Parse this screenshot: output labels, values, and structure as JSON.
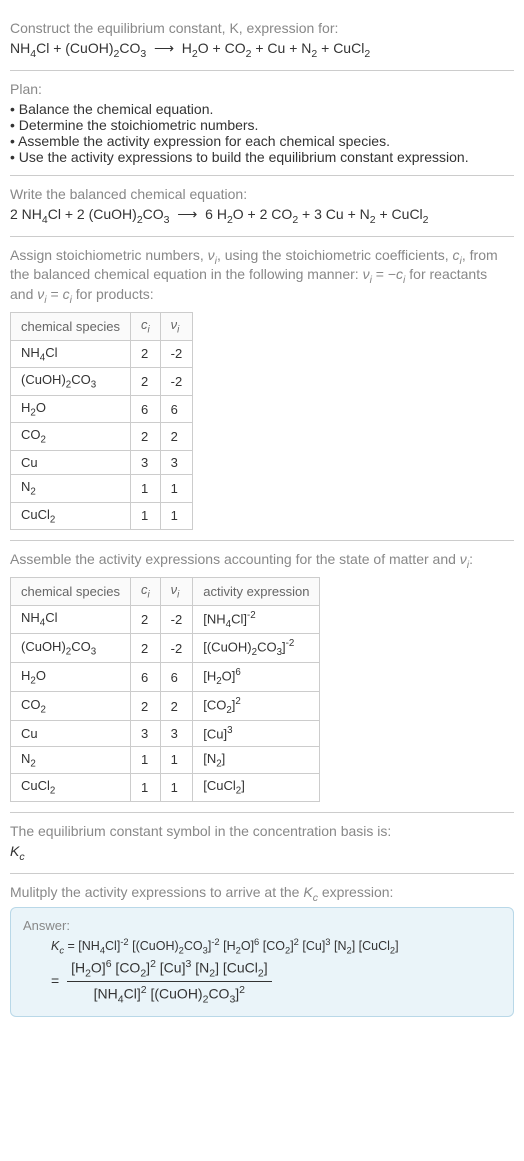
{
  "s1": {
    "prompt": "Construct the equilibrium constant, K, expression for:",
    "equation_html": "NH<sub>4</sub>Cl + (CuOH)<sub>2</sub>CO<sub>3</sub> &nbsp;⟶&nbsp; H<sub>2</sub>O + CO<sub>2</sub> + Cu + N<sub>2</sub> + CuCl<sub>2</sub>"
  },
  "s2": {
    "prompt": "Plan:",
    "b1": "Balance the chemical equation.",
    "b2": "Determine the stoichiometric numbers.",
    "b3": "Assemble the activity expression for each chemical species.",
    "b4": "Use the activity expressions to build the equilibrium constant expression."
  },
  "s3": {
    "prompt": "Write the balanced chemical equation:",
    "equation_html": "2 NH<sub>4</sub>Cl + 2 (CuOH)<sub>2</sub>CO<sub>3</sub> &nbsp;⟶&nbsp; 6 H<sub>2</sub>O + 2 CO<sub>2</sub> + 3 Cu + N<sub>2</sub> + CuCl<sub>2</sub>"
  },
  "s4": {
    "prompt_html": "Assign stoichiometric numbers, <span class='italic'>ν<sub>i</sub></span>, using the stoichiometric coefficients, <span class='italic'>c<sub>i</sub></span>, from the balanced chemical equation in the following manner: <span class='italic'>ν<sub>i</sub></span> = −<span class='italic'>c<sub>i</sub></span> for reactants and <span class='italic'>ν<sub>i</sub></span> = <span class='italic'>c<sub>i</sub></span> for products:",
    "h1": "chemical species",
    "h2_html": "<span class='italic'>c<sub>i</sub></span>",
    "h3_html": "<span class='italic'>ν<sub>i</sub></span>",
    "rows": [
      {
        "sp_html": "NH<sub>4</sub>Cl",
        "c": "2",
        "v": "-2"
      },
      {
        "sp_html": "(CuOH)<sub>2</sub>CO<sub>3</sub>",
        "c": "2",
        "v": "-2"
      },
      {
        "sp_html": "H<sub>2</sub>O",
        "c": "6",
        "v": "6"
      },
      {
        "sp_html": "CO<sub>2</sub>",
        "c": "2",
        "v": "2"
      },
      {
        "sp_html": "Cu",
        "c": "3",
        "v": "3"
      },
      {
        "sp_html": "N<sub>2</sub>",
        "c": "1",
        "v": "1"
      },
      {
        "sp_html": "CuCl<sub>2</sub>",
        "c": "1",
        "v": "1"
      }
    ]
  },
  "s5": {
    "prompt_html": "Assemble the activity expressions accounting for the state of matter and <span class='italic'>ν<sub>i</sub></span>:",
    "h1": "chemical species",
    "h2_html": "<span class='italic'>c<sub>i</sub></span>",
    "h3_html": "<span class='italic'>ν<sub>i</sub></span>",
    "h4": "activity expression",
    "rows": [
      {
        "sp_html": "NH<sub>4</sub>Cl",
        "c": "2",
        "v": "-2",
        "a_html": "[NH<sub>4</sub>Cl]<sup>-2</sup>"
      },
      {
        "sp_html": "(CuOH)<sub>2</sub>CO<sub>3</sub>",
        "c": "2",
        "v": "-2",
        "a_html": "[(CuOH)<sub>2</sub>CO<sub>3</sub>]<sup>-2</sup>"
      },
      {
        "sp_html": "H<sub>2</sub>O",
        "c": "6",
        "v": "6",
        "a_html": "[H<sub>2</sub>O]<sup>6</sup>"
      },
      {
        "sp_html": "CO<sub>2</sub>",
        "c": "2",
        "v": "2",
        "a_html": "[CO<sub>2</sub>]<sup>2</sup>"
      },
      {
        "sp_html": "Cu",
        "c": "3",
        "v": "3",
        "a_html": "[Cu]<sup>3</sup>"
      },
      {
        "sp_html": "N<sub>2</sub>",
        "c": "1",
        "v": "1",
        "a_html": "[N<sub>2</sub>]"
      },
      {
        "sp_html": "CuCl<sub>2</sub>",
        "c": "1",
        "v": "1",
        "a_html": "[CuCl<sub>2</sub>]"
      }
    ]
  },
  "s6": {
    "prompt": "The equilibrium constant symbol in the concentration basis is:",
    "val_html": "<span class='italic'>K<sub>c</sub></span>"
  },
  "s7": {
    "prompt_html": "Mulitply the activity expressions to arrive at the <span class='italic'>K<sub>c</sub></span> expression:",
    "ans_label": "Answer:",
    "line1_html": "<span class='italic'>K<sub>c</sub></span> = [NH<sub>4</sub>Cl]<sup>-2</sup> [(CuOH)<sub>2</sub>CO<sub>3</sub>]<sup>-2</sup> [H<sub>2</sub>O]<sup>6</sup> [CO<sub>2</sub>]<sup>2</sup> [Cu]<sup>3</sup> [N<sub>2</sub>] [CuCl<sub>2</sub>]",
    "frac_num_html": "[H<sub>2</sub>O]<sup>6</sup> [CO<sub>2</sub>]<sup>2</sup> [Cu]<sup>3</sup> [N<sub>2</sub>] [CuCl<sub>2</sub>]",
    "frac_den_html": "[NH<sub>4</sub>Cl]<sup>2</sup> [(CuOH)<sub>2</sub>CO<sub>3</sub>]<sup>2</sup>"
  }
}
